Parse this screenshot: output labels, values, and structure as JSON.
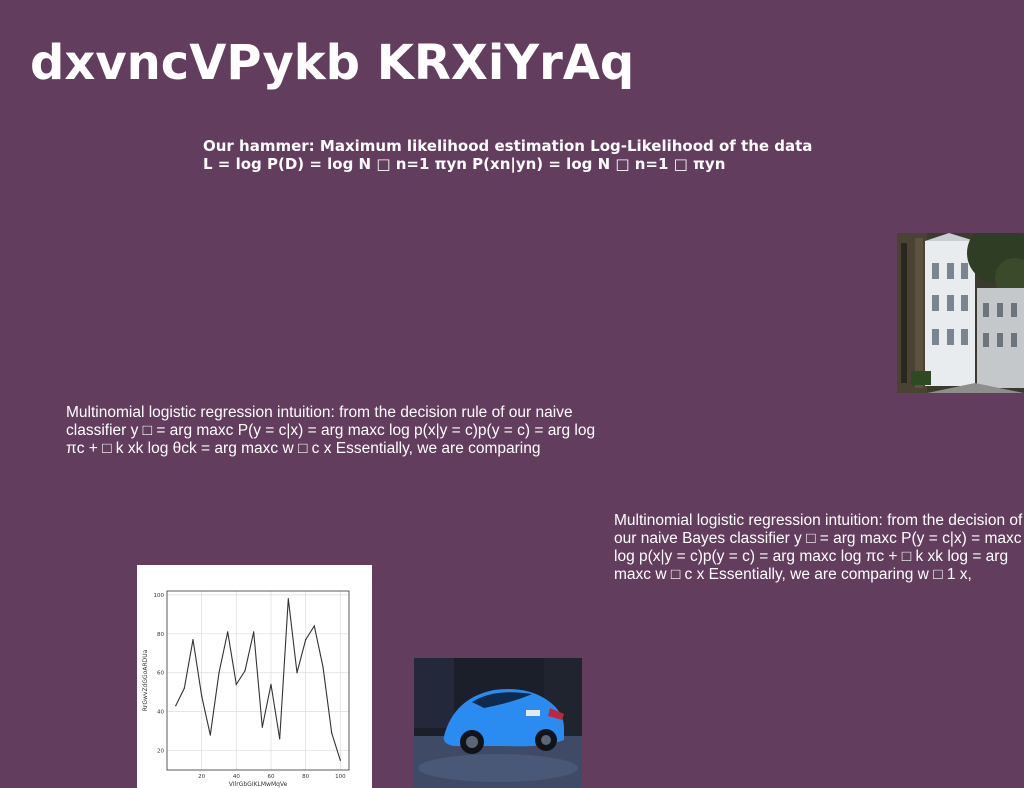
{
  "slide": {
    "title": "dxvncVPykb KRXiYrAq",
    "bold_paragraph": "Our hammer: Maximum likelihood estimation Log-Likelihood of the data L = log P(D) = log N □ n=1 πyn P(xn|yn) = log N □ n=1 □ πyn",
    "paragraph_left": "Multinomial logistic regression intuition: from the decision rule of our naive classifier y □ = arg maxc P(y = c|x) = arg maxc log p(x|y = c)p(y = c) = arg log πc + □ k xk log θck = arg maxc w □ c x Essentially, we are comparing",
    "paragraph_right": "Multinomial logistic regression intuition: from the decision of our naive Bayes classifier y □ = arg maxc P(y = c|x) = maxc log p(x|y = c)p(y = c) = arg maxc log πc + □ k xk log = arg maxc w □ c x Essentially, we are comparing w □ 1 x,"
  },
  "images": {
    "street_photo": "street-photo",
    "car_photo": "car-photo"
  },
  "chart_data": {
    "type": "line",
    "title": "",
    "xlabel": "VIlrGbGIKLMwMqVe",
    "ylabel": "RrGwvZdGGoARDUa",
    "x": [
      5,
      10,
      15,
      20,
      25,
      30,
      35,
      40,
      45,
      50,
      55,
      60,
      65,
      70,
      75,
      80,
      85,
      90,
      95,
      100
    ],
    "y": [
      43,
      52,
      77,
      48,
      28,
      60,
      81,
      54,
      61,
      81,
      32,
      54,
      26,
      98,
      60,
      77,
      84,
      63,
      29,
      15
    ],
    "x_ticks": [
      20,
      40,
      60,
      80,
      100
    ],
    "y_ticks": [
      20,
      40,
      60,
      80,
      100
    ],
    "xlim": [
      0,
      105
    ],
    "ylim": [
      10,
      102
    ],
    "grid": true,
    "line_color": "#333333"
  }
}
